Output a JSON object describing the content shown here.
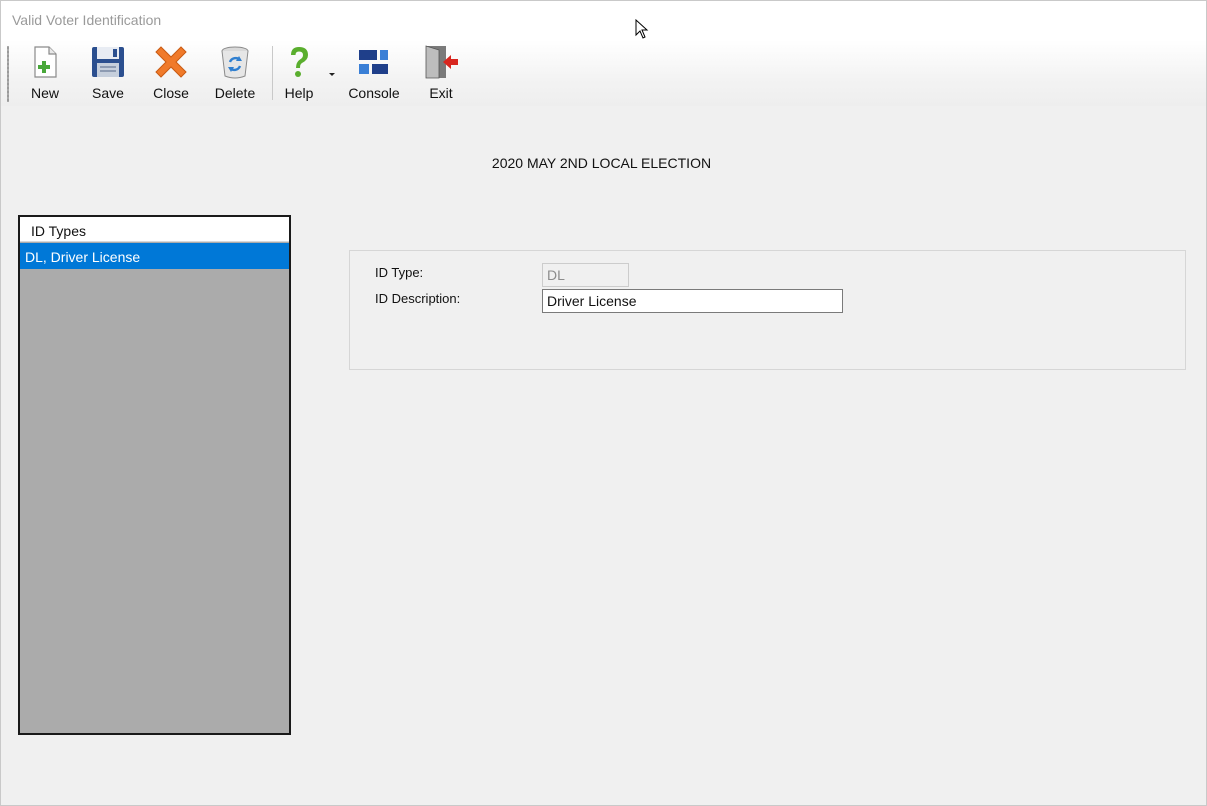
{
  "window": {
    "title": "Valid Voter Identification"
  },
  "toolbar": {
    "new_label": "New",
    "save_label": "Save",
    "close_label": "Close",
    "delete_label": "Delete",
    "help_label": "Help",
    "console_label": "Console",
    "exit_label": "Exit"
  },
  "icons": {
    "new": "new-document-icon",
    "save": "floppy-disk-icon",
    "close": "orange-x-icon",
    "delete": "recycle-bin-icon",
    "help": "question-mark-icon",
    "console": "console-blocks-icon",
    "exit": "exit-door-icon"
  },
  "colors": {
    "selection": "#0078d7",
    "list_background": "#ababab",
    "window_background": "#f0f0f0"
  },
  "election": {
    "title": "2020 MAY 2ND LOCAL ELECTION"
  },
  "id_list": {
    "header": "ID Types",
    "items": [
      {
        "label": "DL, Driver License",
        "selected": true
      }
    ]
  },
  "form": {
    "id_type_label": "ID Type:",
    "id_type_value": "DL",
    "id_description_label": "ID Description:",
    "id_description_value": "Driver License"
  }
}
